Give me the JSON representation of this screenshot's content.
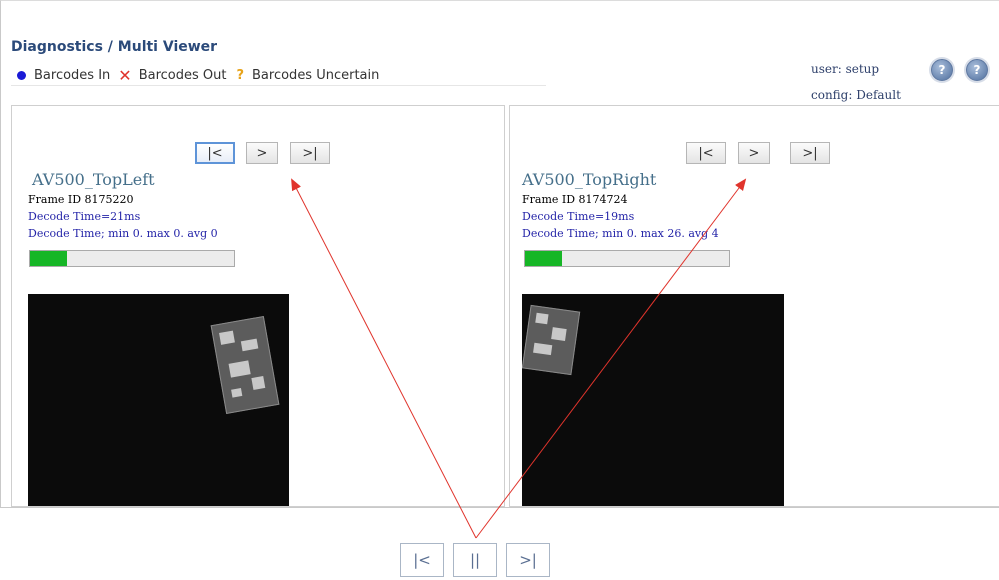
{
  "header": {
    "title": "Diagnostics / Multi Viewer",
    "legend": {
      "in_label": "Barcodes In",
      "out_label": "Barcodes Out",
      "uncertain_label": "Barcodes Uncertain"
    },
    "user": "user: setup",
    "config": "config: Default",
    "help_icon": "?",
    "info_icon": "?"
  },
  "panels": [
    {
      "nav": {
        "first": "|<",
        "next": ">",
        "last": ">|"
      },
      "camera": "AV500_TopLeft",
      "frame_id": "Frame ID 8175220",
      "decode_time": "Decode Time=21ms",
      "decode_stats": "Decode Time; min 0. max 0. avg 0",
      "progress": 0.18
    },
    {
      "nav": {
        "first": "|<",
        "next": ">",
        "last": ">|"
      },
      "camera": "AV500_TopRight",
      "frame_id": "Frame ID 8174724",
      "decode_time": "Decode Time=19ms",
      "decode_stats": "Decode Time; min 0. max 26. avg 4",
      "progress": 0.18
    }
  ],
  "player": {
    "first": "|<",
    "pause": "||",
    "last": ">|"
  },
  "colors": {
    "accent": "#2b4a7a",
    "annotation": "#e0342c",
    "progress": "#16b626"
  }
}
